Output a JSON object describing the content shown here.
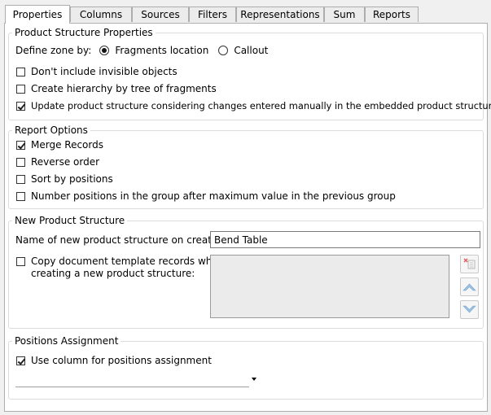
{
  "tabs": [
    {
      "label": "Properties",
      "active": true
    },
    {
      "label": "Columns",
      "active": false
    },
    {
      "label": "Sources",
      "active": false
    },
    {
      "label": "Filters",
      "active": false
    },
    {
      "label": "Representations",
      "active": false
    },
    {
      "label": "Sum",
      "active": false
    },
    {
      "label": "Reports",
      "active": false
    }
  ],
  "product_structure": {
    "legend": "Product Structure Properties",
    "define_zone_label": "Define zone by:",
    "radio_fragments": {
      "label": "Fragments location",
      "checked": true
    },
    "radio_callout": {
      "label": "Callout",
      "checked": false
    },
    "opt_invisible": {
      "label": "Don't include invisible objects",
      "checked": false
    },
    "opt_hierarchy": {
      "label": "Create hierarchy by tree of fragments",
      "checked": false
    },
    "opt_update": {
      "label": "Update product structure considering changes entered manually in the embedded product structures",
      "checked": true
    }
  },
  "report_options": {
    "legend": "Report Options",
    "merge": {
      "label": "Merge Records",
      "checked": true
    },
    "reverse": {
      "label": "Reverse order",
      "checked": false
    },
    "sort": {
      "label": "Sort by positions",
      "checked": false
    },
    "number": {
      "label": "Number positions in the group after maximum value in the previous group",
      "checked": false
    }
  },
  "new_structure": {
    "legend": "New Product Structure",
    "name_label": "Name of new product structure on creation:",
    "name_value": "Bend Table",
    "copy": {
      "label_line1": "Copy document template records when",
      "label_line2": "creating a new product structure:",
      "checked": false
    }
  },
  "positions": {
    "legend": "Positions Assignment",
    "use_column": {
      "label": "Use column for positions assignment",
      "checked": true
    },
    "column_value": ""
  },
  "icons": {
    "clear": "clear-list-icon",
    "up": "move-up-icon",
    "down": "move-down-icon",
    "dropdown": "chevron-down-icon"
  },
  "colors": {
    "panel_bg": "#ffffff",
    "window_bg": "#f0f0f0",
    "border": "#adadad",
    "list_bg": "#ebebeb",
    "arrow_blue": "#9dc2e3"
  }
}
